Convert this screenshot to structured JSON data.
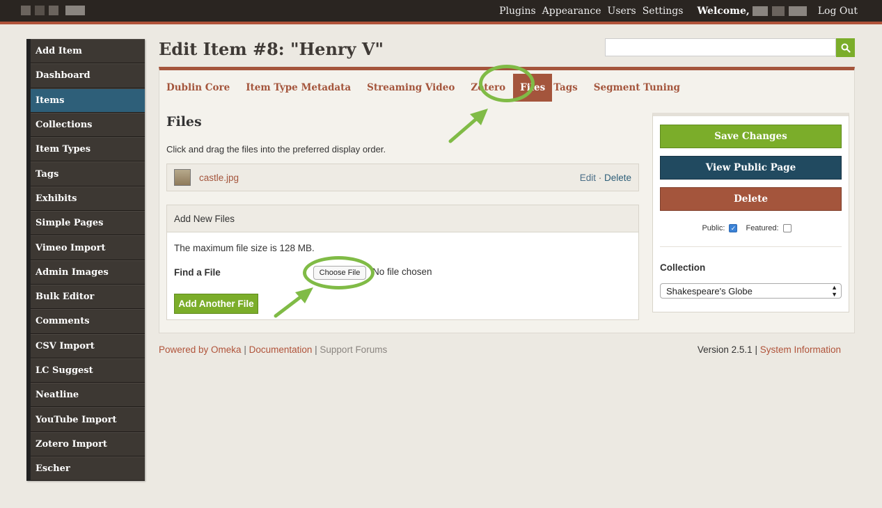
{
  "topbar": {
    "nav": [
      "Plugins",
      "Appearance",
      "Users",
      "Settings"
    ],
    "welcome": "Welcome,",
    "logout": "Log Out"
  },
  "sidebar": {
    "items": [
      {
        "label": "Add Item"
      },
      {
        "label": "Dashboard"
      },
      {
        "label": "Items",
        "active": true
      },
      {
        "label": "Collections"
      },
      {
        "label": "Item Types"
      },
      {
        "label": "Tags"
      },
      {
        "label": "Exhibits"
      },
      {
        "label": "Simple Pages"
      },
      {
        "label": "Vimeo Import"
      },
      {
        "label": "Admin Images"
      },
      {
        "label": "Bulk Editor"
      },
      {
        "label": "Comments"
      },
      {
        "label": "CSV Import"
      },
      {
        "label": "LC Suggest"
      },
      {
        "label": "Neatline"
      },
      {
        "label": "YouTube Import"
      },
      {
        "label": "Zotero Import"
      },
      {
        "label": "Escher"
      }
    ]
  },
  "page": {
    "title": "Edit Item #8: \"Henry V\"",
    "search_placeholder": ""
  },
  "tabs": [
    "Dublin Core",
    "Item Type Metadata",
    "Streaming Video",
    "Zotero",
    "Files",
    "Tags",
    "Segment Tuning"
  ],
  "files": {
    "heading": "Files",
    "hint": "Click and drag the files into the preferred display order.",
    "file_name": "castle.jpg",
    "edit": "Edit",
    "sep": " · ",
    "delete": "Delete"
  },
  "add_files": {
    "header": "Add New Files",
    "max_size": "The maximum file size is 128 MB.",
    "find_label": "Find a File",
    "choose_button": "Choose File",
    "no_file": "No file chosen",
    "add_another": "Add Another File"
  },
  "side_panel": {
    "save": "Save Changes",
    "view_public": "View Public Page",
    "delete": "Delete",
    "public_label": "Public:",
    "public_checked": true,
    "featured_label": "Featured:",
    "featured_checked": false,
    "collection_label": "Collection",
    "collection_value": "Shakespeare's Globe"
  },
  "footer": {
    "powered": "Powered by Omeka",
    "documentation": "Documentation",
    "support": "Support Forums",
    "sep": " | ",
    "version": "Version 2.5.1",
    "system_info": "System Information"
  },
  "colors": {
    "accent": "#a4553c",
    "green": "#7bad2a",
    "active_nav": "#2e5f79",
    "annotation": "#80bb46"
  }
}
